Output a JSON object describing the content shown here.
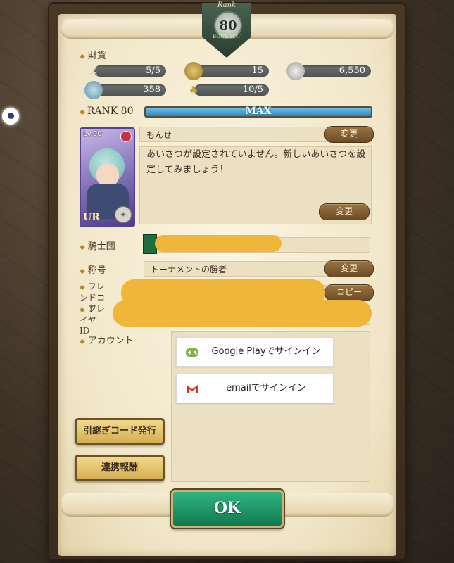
{
  "badge": {
    "label": "Rank",
    "value": "80",
    "ribbon": "BONE HAT"
  },
  "currency": {
    "section_label": "財貨",
    "items": [
      {
        "icon": "sword-icon",
        "value": "5/5"
      },
      {
        "icon": "gold-coin-icon",
        "value": "15"
      },
      {
        "icon": "silver-coin-icon",
        "value": "6,550"
      },
      {
        "icon": "gem-icon",
        "value": "358"
      },
      {
        "icon": "seed-icon",
        "value": "10/5"
      }
    ]
  },
  "rank": {
    "label": "RANK 80",
    "progress": 1.0,
    "max_label": "MAX"
  },
  "character": {
    "level_label": "Lv.90",
    "rarity": "UR"
  },
  "profile": {
    "name": "もんせ",
    "change_label": "変更",
    "greeting": "あいさつが設定されていません。新しいあいさつを設定してみましょう！",
    "greeting_change_label": "変更"
  },
  "knights": {
    "label": "騎士団"
  },
  "title": {
    "label": "称号",
    "value": "トーナメントの勝者",
    "change_label": "変更"
  },
  "friend_code": {
    "label": "フレンドコード",
    "copy_label": "コピー"
  },
  "player_id": {
    "label": "プレイヤーID"
  },
  "account": {
    "label": "アカウント",
    "google_label": "Google Playでサインイン",
    "email_label": "emailでサインイン"
  },
  "buttons": {
    "transfer_code": "引継ぎコード発行",
    "link_reward": "連携報酬",
    "ok": "OK"
  },
  "colors": {
    "accent_green": "#1e9a68",
    "panel": "#f4ead0",
    "rank_bar": "#3e9fd4",
    "redaction": "#f0b63a"
  }
}
